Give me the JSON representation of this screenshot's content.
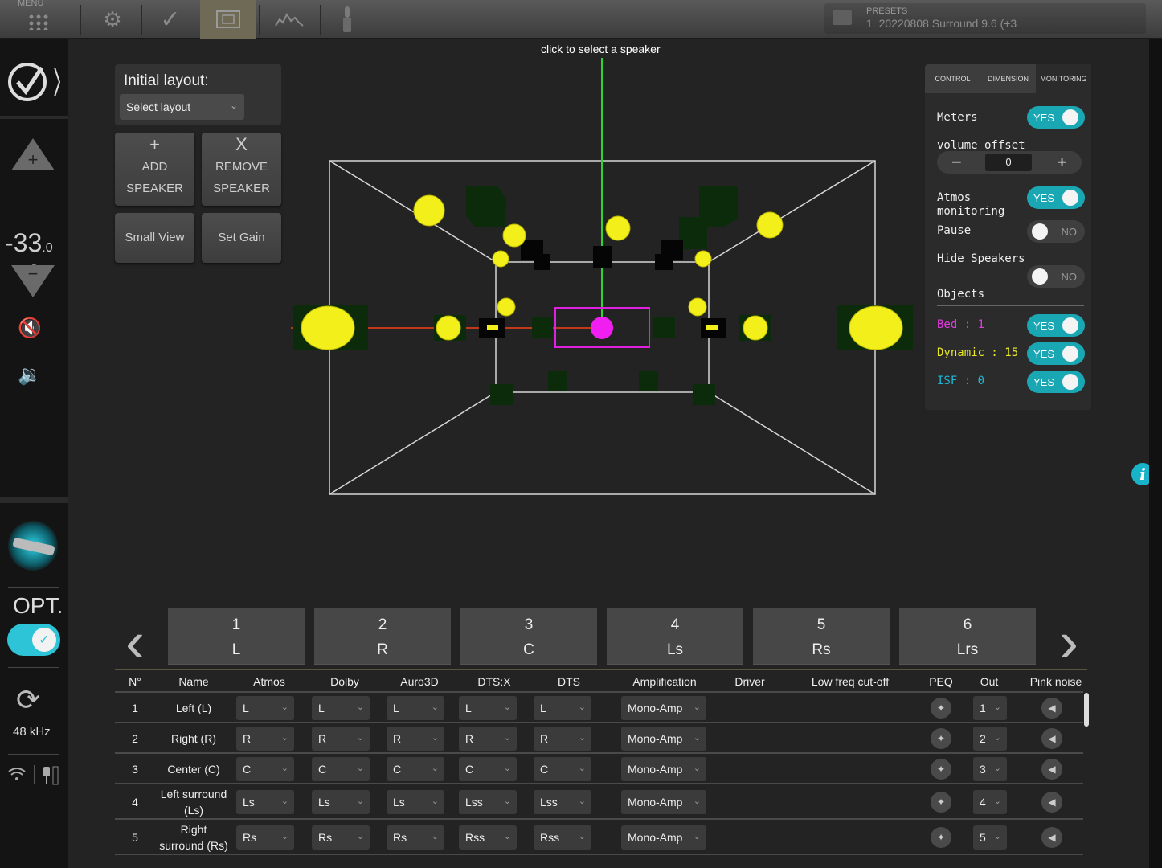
{
  "topbar": {
    "menu_label": "MENU",
    "presets_label": "PRESETS",
    "presets_value": "1. 20220808 Surround 9.6 (+3"
  },
  "sidebar": {
    "volume_main": "-33",
    "volume_decimal": ".0",
    "volume_unit": "dB",
    "opt_label": "OPT.",
    "opt_toggle_on": true,
    "sample_rate": "48 kHz"
  },
  "layout_panel": {
    "title": "Initial layout:",
    "select_placeholder": "Select layout",
    "add_symbol": "+",
    "add_line1": "ADD",
    "add_line2": "SPEAKER",
    "remove_symbol": "X",
    "remove_line1": "REMOVE",
    "remove_line2": "SPEAKER",
    "small_view": "Small View",
    "set_gain": "Set Gain"
  },
  "view": {
    "hint": "click to select a speaker"
  },
  "right_panel": {
    "tabs": [
      "CONTROL",
      "DIMENSION",
      "MONITORING"
    ],
    "active_tab": "MONITORING",
    "meters_label": "Meters",
    "meters_value": "YES",
    "volume_offset_label": "volume offset",
    "volume_offset_value": "0",
    "atmos_label_1": "Atmos",
    "atmos_label_2": "monitoring",
    "atmos_value": "YES",
    "pause_label": "Pause",
    "pause_value": "NO",
    "hide_label": "Hide Speakers",
    "hide_value": "NO",
    "objects_label": "Objects",
    "bed_label": "Bed : 1",
    "bed_value": "YES",
    "bed_color": "#e23be0",
    "dynamic_label": "Dynamic : 15",
    "dynamic_value": "YES",
    "dynamic_color": "#e8e82a",
    "isf_label": "ISF : 0",
    "isf_value": "YES",
    "isf_color": "#1fb7d6"
  },
  "speaker_tabs": [
    {
      "num": "1",
      "code": "L"
    },
    {
      "num": "2",
      "code": "R"
    },
    {
      "num": "3",
      "code": "C"
    },
    {
      "num": "4",
      "code": "Ls"
    },
    {
      "num": "5",
      "code": "Rs"
    },
    {
      "num": "6",
      "code": "Lrs"
    }
  ],
  "table": {
    "headers": [
      "N°",
      "Name",
      "Atmos",
      "Dolby",
      "Auro3D",
      "DTS:X",
      "DTS",
      "Amplification",
      "Driver",
      "Low freq cut-off",
      "PEQ",
      "Out",
      "Pink noise"
    ],
    "rows": [
      {
        "n": "1",
        "name1": "Left (L)",
        "name2": "",
        "atmos": "L",
        "dolby": "L",
        "auro": "L",
        "dtsx": "L",
        "dts": "L",
        "amp": "Mono-Amp",
        "out": "1"
      },
      {
        "n": "2",
        "name1": "Right (R)",
        "name2": "",
        "atmos": "R",
        "dolby": "R",
        "auro": "R",
        "dtsx": "R",
        "dts": "R",
        "amp": "Mono-Amp",
        "out": "2"
      },
      {
        "n": "3",
        "name1": "Center (C)",
        "name2": "",
        "atmos": "C",
        "dolby": "C",
        "auro": "C",
        "dtsx": "C",
        "dts": "C",
        "amp": "Mono-Amp",
        "out": "3"
      },
      {
        "n": "4",
        "name1": "Left surround",
        "name2": "(Ls)",
        "atmos": "Ls",
        "dolby": "Ls",
        "auro": "Ls",
        "dtsx": "Lss",
        "dts": "Lss",
        "amp": "Mono-Amp",
        "out": "4"
      },
      {
        "n": "5",
        "name1": "Right",
        "name2": "surround (Rs)",
        "atmos": "Rs",
        "dolby": "Rs",
        "auro": "Rs",
        "dtsx": "Rss",
        "dts": "Rss",
        "amp": "Mono-Amp",
        "out": "5"
      }
    ]
  }
}
